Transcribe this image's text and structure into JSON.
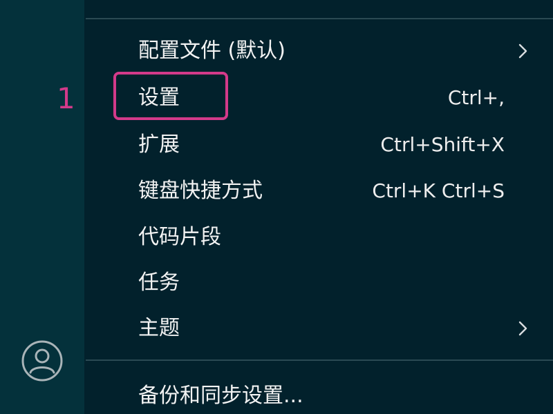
{
  "annotation": {
    "step_number": "1",
    "highlight_color": "#d33a8a"
  },
  "activity_bar": {
    "account_icon": "account-icon"
  },
  "menu": {
    "items": [
      {
        "label": "配置文件 (默认)",
        "shortcut": "",
        "submenu": true
      },
      {
        "label": "设置",
        "shortcut": "Ctrl+,",
        "submenu": false
      },
      {
        "label": "扩展",
        "shortcut": "Ctrl+Shift+X",
        "submenu": false
      },
      {
        "label": "键盘快捷方式",
        "shortcut": "Ctrl+K Ctrl+S",
        "submenu": false
      },
      {
        "label": "代码片段",
        "shortcut": "",
        "submenu": false
      },
      {
        "label": "任务",
        "shortcut": "",
        "submenu": false
      },
      {
        "label": "主题",
        "shortcut": "",
        "submenu": true
      },
      {
        "label": "备份和同步设置...",
        "shortcut": "",
        "submenu": false
      }
    ]
  }
}
